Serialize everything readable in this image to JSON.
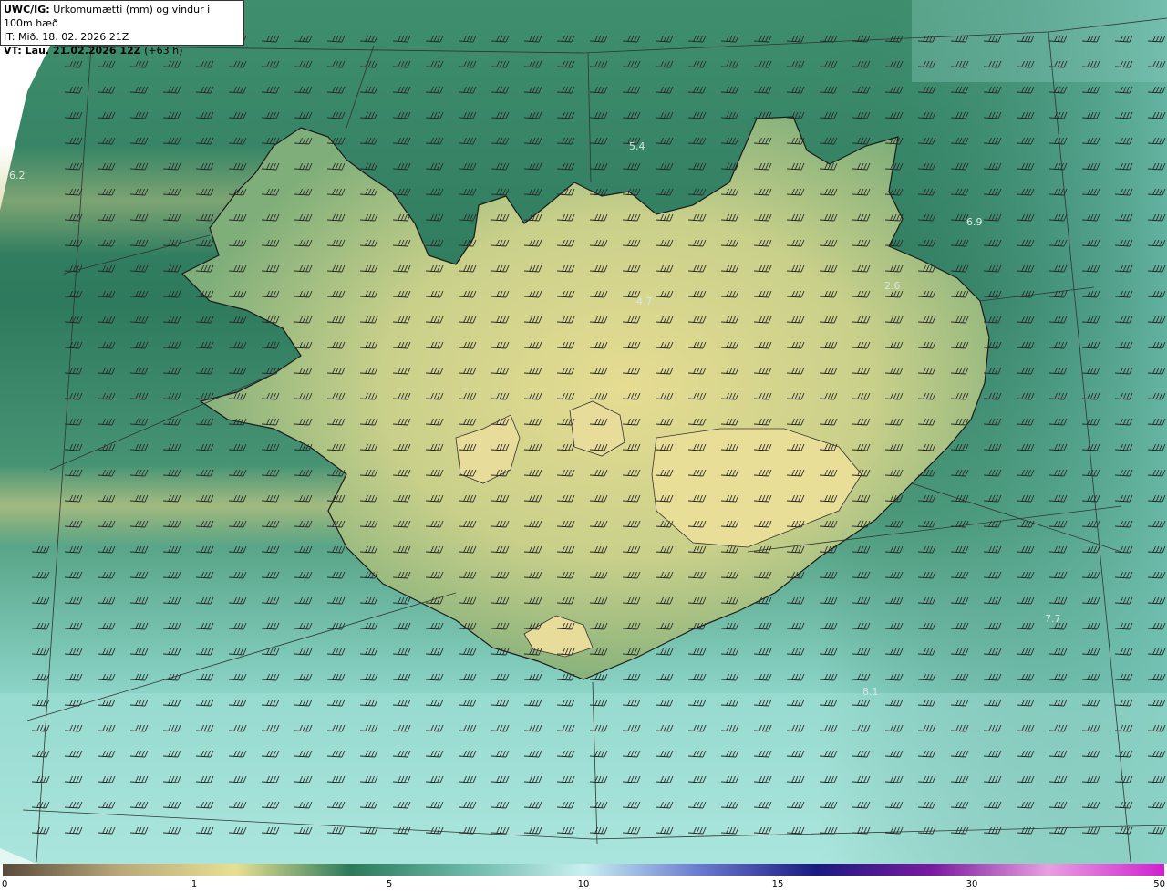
{
  "header": {
    "product": "UWC/IG:",
    "description": "Úrkomumætti (mm) og vindur i 100m hæð",
    "init_time": "IT: Mið. 18. 02. 2026 21Z",
    "valid_prefix": "VT: Lau. 21.02.2026 12Z",
    "valid_suffix": "(+63 h)"
  },
  "colorbar": {
    "ticks": [
      "0",
      "1",
      "5",
      "10",
      "15",
      "30",
      "50"
    ],
    "colors": [
      "#5a4a3a",
      "#b8a878",
      "#e8e090",
      "#2a7a5a",
      "#6ab8a8",
      "#c8f0f0",
      "#6a7ad0",
      "#1a1a80",
      "#7a1aa0",
      "#e8a0e0",
      "#d020d0"
    ]
  },
  "map": {
    "value_labels": [
      "6.2",
      "5.4",
      "6.9",
      "2.6",
      "4.7",
      "7.7",
      "8.1"
    ],
    "colors": {
      "ocean_dark": "#2f7a5e",
      "ocean_light": "#7fcfc4",
      "land": "#c8cf86",
      "land_high": "#e3d98f",
      "coast": "#1a1a1a"
    },
    "wind_barbs": "northwesterly-westerly wind barbs over region"
  }
}
